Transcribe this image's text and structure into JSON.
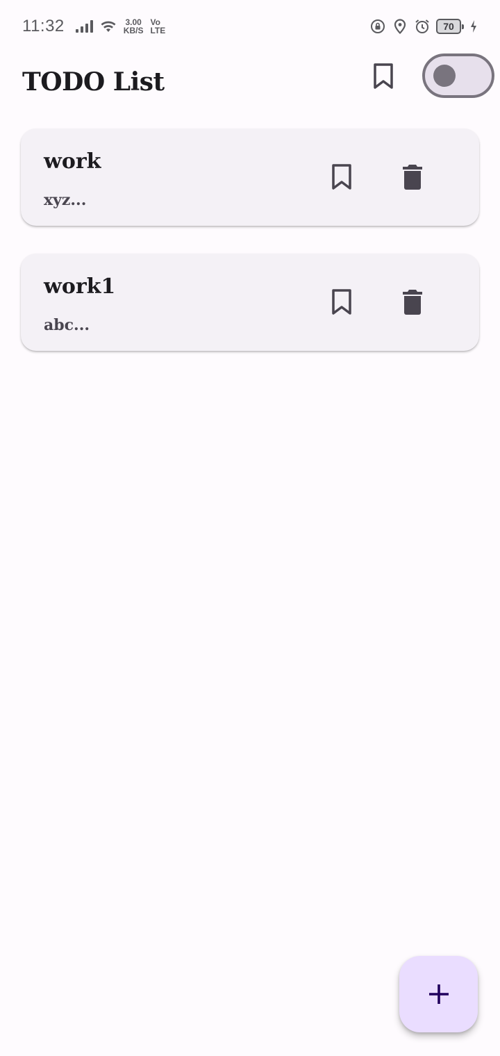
{
  "status_bar": {
    "time": "11:32",
    "speed_value": "3.00",
    "speed_unit": "KB/S",
    "volte_top": "Vo",
    "volte_bottom": "LTE",
    "battery": "70",
    "icons": [
      "signal-icon",
      "wifi-icon",
      "lock-rotation-icon",
      "location-icon",
      "alarm-icon",
      "battery-icon",
      "charging-icon"
    ]
  },
  "app_bar": {
    "title": "TODO List",
    "bookmark_icon": "bookmark-outline-icon",
    "theme_toggle": {
      "on": false
    }
  },
  "todos": [
    {
      "title": "work",
      "subtitle": "xyz...",
      "bookmark_icon": "bookmark-outline-icon",
      "delete_icon": "trash-icon"
    },
    {
      "title": "work1",
      "subtitle": "abc...",
      "bookmark_icon": "bookmark-outline-icon",
      "delete_icon": "trash-icon"
    }
  ],
  "fab": {
    "icon": "plus-icon"
  },
  "colors": {
    "background": "#fefbfe",
    "card": "#f4f1f6",
    "title_text": "#1c1b1f",
    "subtitle_text": "#49454f",
    "icon": "#49454f",
    "fab_bg": "#eaddff",
    "fab_icon": "#21005d",
    "toggle_track": "#e7e0ec",
    "toggle_outline": "#79747e"
  }
}
